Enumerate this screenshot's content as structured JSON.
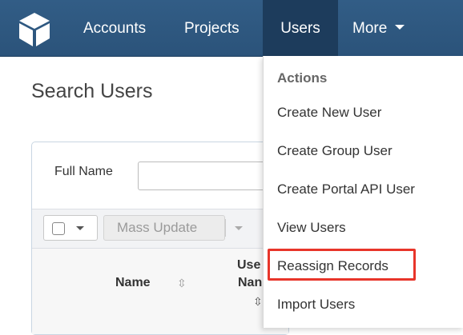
{
  "nav": {
    "items": [
      {
        "label": "Accounts"
      },
      {
        "label": "Projects"
      },
      {
        "label": "Users"
      },
      {
        "label": "More"
      }
    ],
    "active": "Users",
    "logo_icon": "cube-icon",
    "colors": {
      "bar": "#2f5a82",
      "active": "#1d3c5c"
    }
  },
  "page": {
    "title": "Search Users"
  },
  "filter": {
    "full_name_label": "Full Name",
    "full_name_value": ""
  },
  "toolbar": {
    "mass_update_label": "Mass Update"
  },
  "table": {
    "columns": [
      {
        "label": "Name"
      },
      {
        "label_line1": "Use",
        "label_line2": "Nan"
      }
    ],
    "sort_icon": "sort-icon"
  },
  "dropdown": {
    "header": "Actions",
    "items": [
      {
        "label": "Create New User"
      },
      {
        "label": "Create Group User"
      },
      {
        "label": "Create Portal API User"
      },
      {
        "label": "View Users"
      },
      {
        "label": "Reassign Records",
        "highlighted": true
      },
      {
        "label": "Import Users"
      }
    ],
    "highlight_color": "#e8352a"
  }
}
